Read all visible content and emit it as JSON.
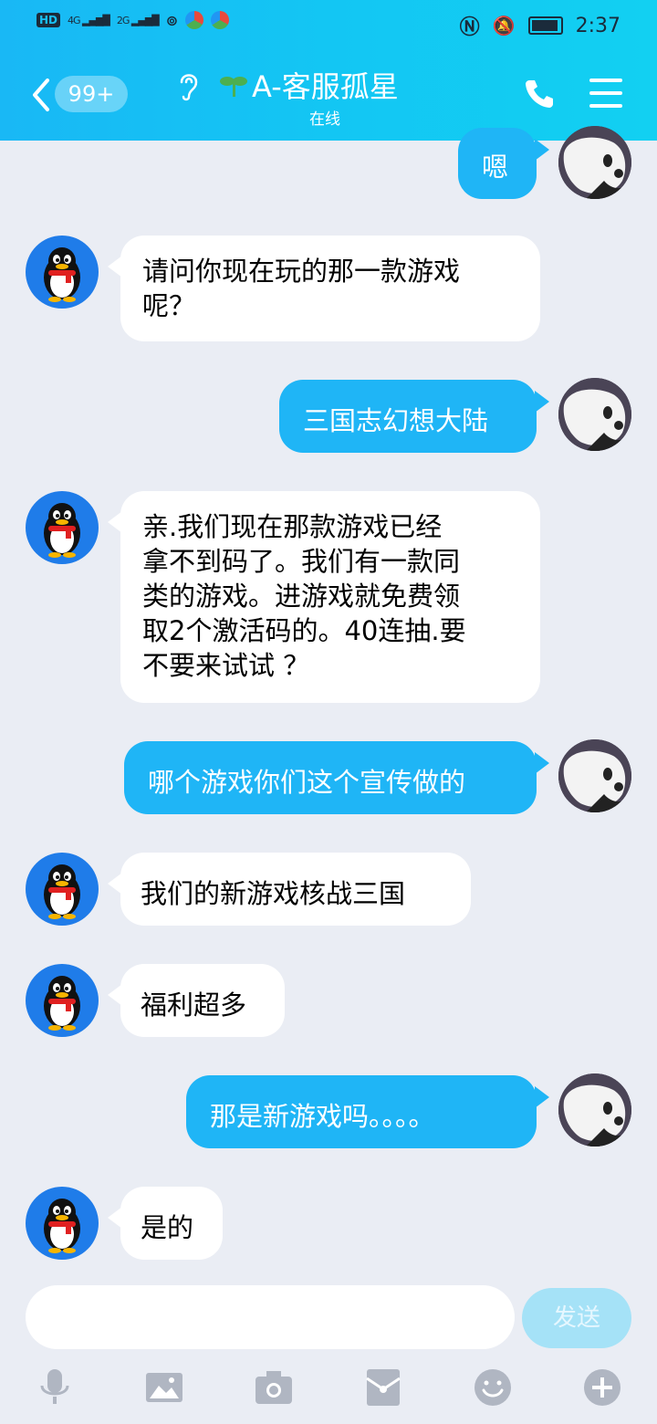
{
  "status_bar": {
    "left_icons": [
      "hd-icon",
      "signal-4g-icon",
      "signal-2g-icon",
      "data-icon",
      "app-icon-1",
      "app-icon-2"
    ],
    "hd": "HD",
    "net1": "4G",
    "net2": "2G",
    "time": "2:37",
    "right_icons": [
      "nfc-icon",
      "mute-icon",
      "battery-icon"
    ]
  },
  "header": {
    "back_icon": "chevron-left-icon",
    "unread_badge": "99+",
    "title": "A-客服孤星",
    "subtitle": "在线",
    "icons": [
      "ear-icon",
      "sprout-icon",
      "phone-icon",
      "menu-icon"
    ]
  },
  "messages": [
    {
      "side": "right",
      "text": "嗯"
    },
    {
      "side": "left",
      "lines": [
        "请问你现在玩的那一款游戏",
        "呢？"
      ]
    },
    {
      "side": "right",
      "text": "三国志幻想大陆"
    },
    {
      "side": "left",
      "lines": [
        "亲.我们现在那款游戏已经",
        "拿不到码了。我们有一款同",
        "类的游戏。进游戏就免费领",
        "取2个激活码的。40连抽.要",
        "不要来试试 ？"
      ]
    },
    {
      "side": "right",
      "text": "哪个游戏你们这个宣传做的"
    },
    {
      "side": "left",
      "text": "我们的新游戏核战三国"
    },
    {
      "side": "left",
      "text": "福利超多"
    },
    {
      "side": "right",
      "text": "那是新游戏吗。。。。"
    },
    {
      "side": "left",
      "text": "是的"
    }
  ],
  "composer": {
    "input_value": "",
    "send_label": "发送"
  },
  "toolbar": {
    "icons": [
      "microphone-icon",
      "image-icon",
      "camera-icon",
      "red-packet-icon",
      "emoji-icon",
      "plus-icon"
    ]
  },
  "colors": {
    "header_start": "#19b8f5",
    "header_end": "#12d0f2",
    "outgoing_bubble": "#1fb5f6",
    "incoming_bubble": "#ffffff",
    "background": "#eaedf4",
    "send_disabled": "#a5e2f7"
  }
}
